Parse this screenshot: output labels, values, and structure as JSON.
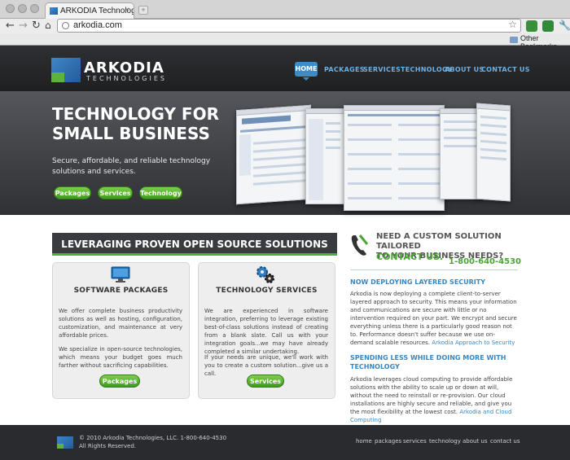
{
  "browser": {
    "tab_title": "ARKODIA Technologies, LLC.",
    "tab_close": "×",
    "new_tab": "+",
    "back_icon": "back-arrow-icon",
    "forward_icon": "forward-arrow-icon",
    "reload_icon": "reload-icon",
    "home_icon": "home-icon",
    "url": "arkodia.com",
    "bookmark_star_icon": "star-icon",
    "extensions": [
      {
        "name": "stumbleupon-icon",
        "label": "SU",
        "color": "#3a8f3a"
      },
      {
        "name": "green-extension-icon",
        "label": "G",
        "color": "#2f8a3a"
      }
    ],
    "settings_icon": "wrench-icon",
    "other_bookmarks": "Other Bookmarks"
  },
  "header": {
    "logo_name": "ARKODIA",
    "logo_sub": "TECHNOLOGIES",
    "nav": [
      {
        "label": "HOME",
        "active": true
      },
      {
        "label": "PACKAGES"
      },
      {
        "label": "SERVICES"
      },
      {
        "label": "TECHNOLOGY"
      },
      {
        "label": "ABOUT US"
      },
      {
        "label": "CONTACT US"
      }
    ]
  },
  "hero": {
    "title_line1": "TECHNOLOGY FOR",
    "title_line2": "SMALL BUSINESS",
    "subtitle": "Secure, affordable, and reliable technology solutions and services.",
    "buttons": [
      "Packages",
      "Services",
      "Technology"
    ]
  },
  "main": {
    "banner": "LEVERAGING PROVEN OPEN SOURCE SOLUTIONS",
    "cards": [
      {
        "icon": "monitor-icon",
        "title": "SOFTWARE PACKAGES",
        "p1": "We offer complete business productivity solutions as well as hosting, configuration, customization, and maintenance at very affordable prices.",
        "p2": "We specialize in open-source technologies, which means your budget goes much farther without sacrificing capabilities.",
        "button": "Packages"
      },
      {
        "icon": "gears-icon",
        "title": "TECHNOLOGY SERVICES",
        "p1": "We are experienced in software integration, preferring to leverage existing best-of-class solutions instead of creating from a blank slate. Call us with your integration goals...we may have already completed a similar undertaking.",
        "p2": "If your needs are unique, we'll work with you to create a custom solution...give us a call.",
        "button": "Services"
      }
    ]
  },
  "sidebar": {
    "cta_line1": "NEED A CUSTOM SOLUTION TAILORED",
    "cta_line2": "TO YOUR BUSINESS NEEDS?",
    "cta_contact": "CONTACT US.",
    "phone": "1-800-640-4530",
    "sections": [
      {
        "heading": "NOW DEPLOYING LAYERED SECURITY",
        "body": "Arkodia is now deploying a complete client-to-server layered approach to security. This means your information and communications are secure with little or no intervention required on your part. We encrypt and secure everything unless there is a particularly good reason not to. Performance doesn't suffer because we use on-demand scalable resources.",
        "link": "Arkodia Approach to Security"
      },
      {
        "heading": "SPENDING LESS WHILE DOING MORE WITH TECHNOLOGY",
        "body": "Arkodia leverages cloud computing to provide affordable solutions with the ability to scale up or down at will, without the need to reinstall or re-provision. Our cloud installations are highly secure and reliable, and give you the most flexibility at the lowest cost.",
        "link": "Arkodia and Cloud Computing"
      }
    ]
  },
  "footer": {
    "copyright": "© 2010 Arkodia Technologies, LLC.  1-800-640-4530",
    "rights": "All Rights Reserved.",
    "links": [
      "home",
      "packages",
      "services",
      "technology",
      "about us",
      "contact us"
    ]
  },
  "colors": {
    "accent_blue": "#3a86bf",
    "accent_green": "#4aa535",
    "header_dark": "#2a2b2e"
  }
}
